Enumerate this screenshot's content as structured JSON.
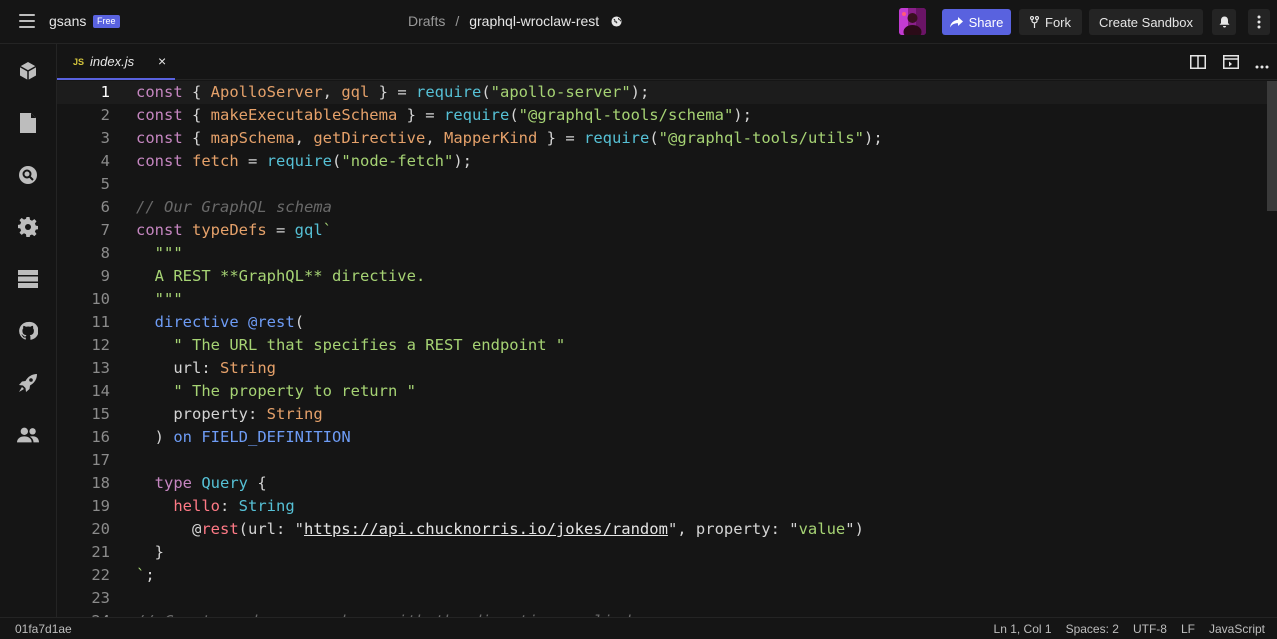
{
  "header": {
    "workspace": "gsans",
    "plan_badge": "Free",
    "breadcrumb_drafts": "Drafts",
    "breadcrumb_separator": "/",
    "sandbox_name": "graphql-wroclaw-rest",
    "share_label": "Share",
    "fork_label": "Fork",
    "create_label": "Create Sandbox"
  },
  "tab": {
    "lang_badge": "JS",
    "filename": "index.js",
    "close_glyph": "×"
  },
  "editor": {
    "lines": [
      {
        "n": "1",
        "t": [
          [
            "kw",
            "const"
          ],
          [
            "txt",
            " { "
          ],
          [
            "orange",
            "ApolloServer"
          ],
          [
            "txt",
            ", "
          ],
          [
            "orange",
            "gql"
          ],
          [
            "txt",
            " } = "
          ],
          [
            "fn",
            "require"
          ],
          [
            "txt",
            "("
          ],
          [
            "str",
            "\"apollo-server\""
          ],
          [
            "txt",
            ");"
          ]
        ]
      },
      {
        "n": "2",
        "t": [
          [
            "kw",
            "const"
          ],
          [
            "txt",
            " { "
          ],
          [
            "orange",
            "makeExecutableSchema"
          ],
          [
            "txt",
            " } = "
          ],
          [
            "fn",
            "require"
          ],
          [
            "txt",
            "("
          ],
          [
            "str",
            "\"@graphql-tools/schema\""
          ],
          [
            "txt",
            ");"
          ]
        ]
      },
      {
        "n": "3",
        "t": [
          [
            "kw",
            "const"
          ],
          [
            "txt",
            " { "
          ],
          [
            "orange",
            "mapSchema"
          ],
          [
            "txt",
            ", "
          ],
          [
            "orange",
            "getDirective"
          ],
          [
            "txt",
            ", "
          ],
          [
            "orange",
            "MapperKind"
          ],
          [
            "txt",
            " } = "
          ],
          [
            "fn",
            "require"
          ],
          [
            "txt",
            "("
          ],
          [
            "str",
            "\"@graphql-tools/utils\""
          ],
          [
            "txt",
            ");"
          ]
        ]
      },
      {
        "n": "4",
        "t": [
          [
            "kw",
            "const"
          ],
          [
            "txt",
            " "
          ],
          [
            "orange",
            "fetch"
          ],
          [
            "txt",
            " = "
          ],
          [
            "fn",
            "require"
          ],
          [
            "txt",
            "("
          ],
          [
            "str",
            "\"node-fetch\""
          ],
          [
            "txt",
            ");"
          ]
        ]
      },
      {
        "n": "5",
        "t": []
      },
      {
        "n": "6",
        "t": [
          [
            "cmt",
            "// Our GraphQL schema"
          ]
        ]
      },
      {
        "n": "7",
        "t": [
          [
            "kw",
            "const"
          ],
          [
            "txt",
            " "
          ],
          [
            "orange",
            "typeDefs"
          ],
          [
            "txt",
            " = "
          ],
          [
            "fn",
            "gql"
          ],
          [
            "str",
            "`"
          ]
        ]
      },
      {
        "n": "8",
        "t": [
          [
            "str",
            "  \"\"\""
          ]
        ]
      },
      {
        "n": "9",
        "t": [
          [
            "str",
            "  A REST **GraphQL** directive."
          ]
        ]
      },
      {
        "n": "10",
        "t": [
          [
            "str",
            "  \"\"\""
          ]
        ]
      },
      {
        "n": "11",
        "t": [
          [
            "txt",
            "  "
          ],
          [
            "blue",
            "directive"
          ],
          [
            "txt",
            " "
          ],
          [
            "blue",
            "@rest"
          ],
          [
            "txt",
            "("
          ]
        ]
      },
      {
        "n": "12",
        "t": [
          [
            "str",
            "    \" The URL that specifies a REST endpoint \""
          ]
        ]
      },
      {
        "n": "13",
        "t": [
          [
            "txt",
            "    url: "
          ],
          [
            "orange",
            "String"
          ]
        ]
      },
      {
        "n": "14",
        "t": [
          [
            "str",
            "    \" The property to return \""
          ]
        ]
      },
      {
        "n": "15",
        "t": [
          [
            "txt",
            "    property: "
          ],
          [
            "orange",
            "String"
          ]
        ]
      },
      {
        "n": "16",
        "t": [
          [
            "txt",
            "  ) "
          ],
          [
            "blue",
            "on"
          ],
          [
            "txt",
            " "
          ],
          [
            "blue",
            "FIELD_DEFINITION"
          ]
        ]
      },
      {
        "n": "17",
        "t": []
      },
      {
        "n": "18",
        "t": [
          [
            "txt",
            "  "
          ],
          [
            "kw",
            "type"
          ],
          [
            "txt",
            " "
          ],
          [
            "fn",
            "Query"
          ],
          [
            "txt",
            " {"
          ]
        ]
      },
      {
        "n": "19",
        "t": [
          [
            "txt",
            "    "
          ],
          [
            "red",
            "hello"
          ],
          [
            "txt",
            ": "
          ],
          [
            "fn",
            "String"
          ]
        ]
      },
      {
        "n": "20",
        "t": [
          [
            "txt",
            "      @"
          ],
          [
            "red",
            "rest"
          ],
          [
            "txt",
            "(url: \""
          ],
          [
            "ul",
            "https://api.chucknorris.io/jokes/random"
          ],
          [
            "txt",
            "\", property: \""
          ],
          [
            "str",
            "value"
          ],
          [
            "txt",
            "\")"
          ]
        ]
      },
      {
        "n": "21",
        "t": [
          [
            "txt",
            "  }"
          ]
        ]
      },
      {
        "n": "22",
        "t": [
          [
            "str",
            "`"
          ],
          [
            "txt",
            ";"
          ]
        ]
      },
      {
        "n": "23",
        "t": []
      },
      {
        "n": "24",
        "t": [
          [
            "cmt",
            "// Create and map a schema with the directive applied"
          ]
        ]
      }
    ]
  },
  "status": {
    "commit": "01fa7d1ae",
    "position": "Ln 1, Col 1",
    "spaces": "Spaces: 2",
    "encoding": "UTF-8",
    "eol": "LF",
    "language": "JavaScript"
  },
  "colors": {
    "accent": "#5962df",
    "background": "#151515"
  },
  "icons": [
    "menu-icon",
    "globe-icon",
    "share-icon",
    "fork-icon",
    "bell-icon",
    "more-vertical-icon",
    "cube-icon",
    "file-icon",
    "search-icon",
    "gear-icon",
    "server-icon",
    "github-icon",
    "rocket-icon",
    "users-icon",
    "split-view-icon",
    "preview-icon",
    "more-horizontal-icon"
  ]
}
